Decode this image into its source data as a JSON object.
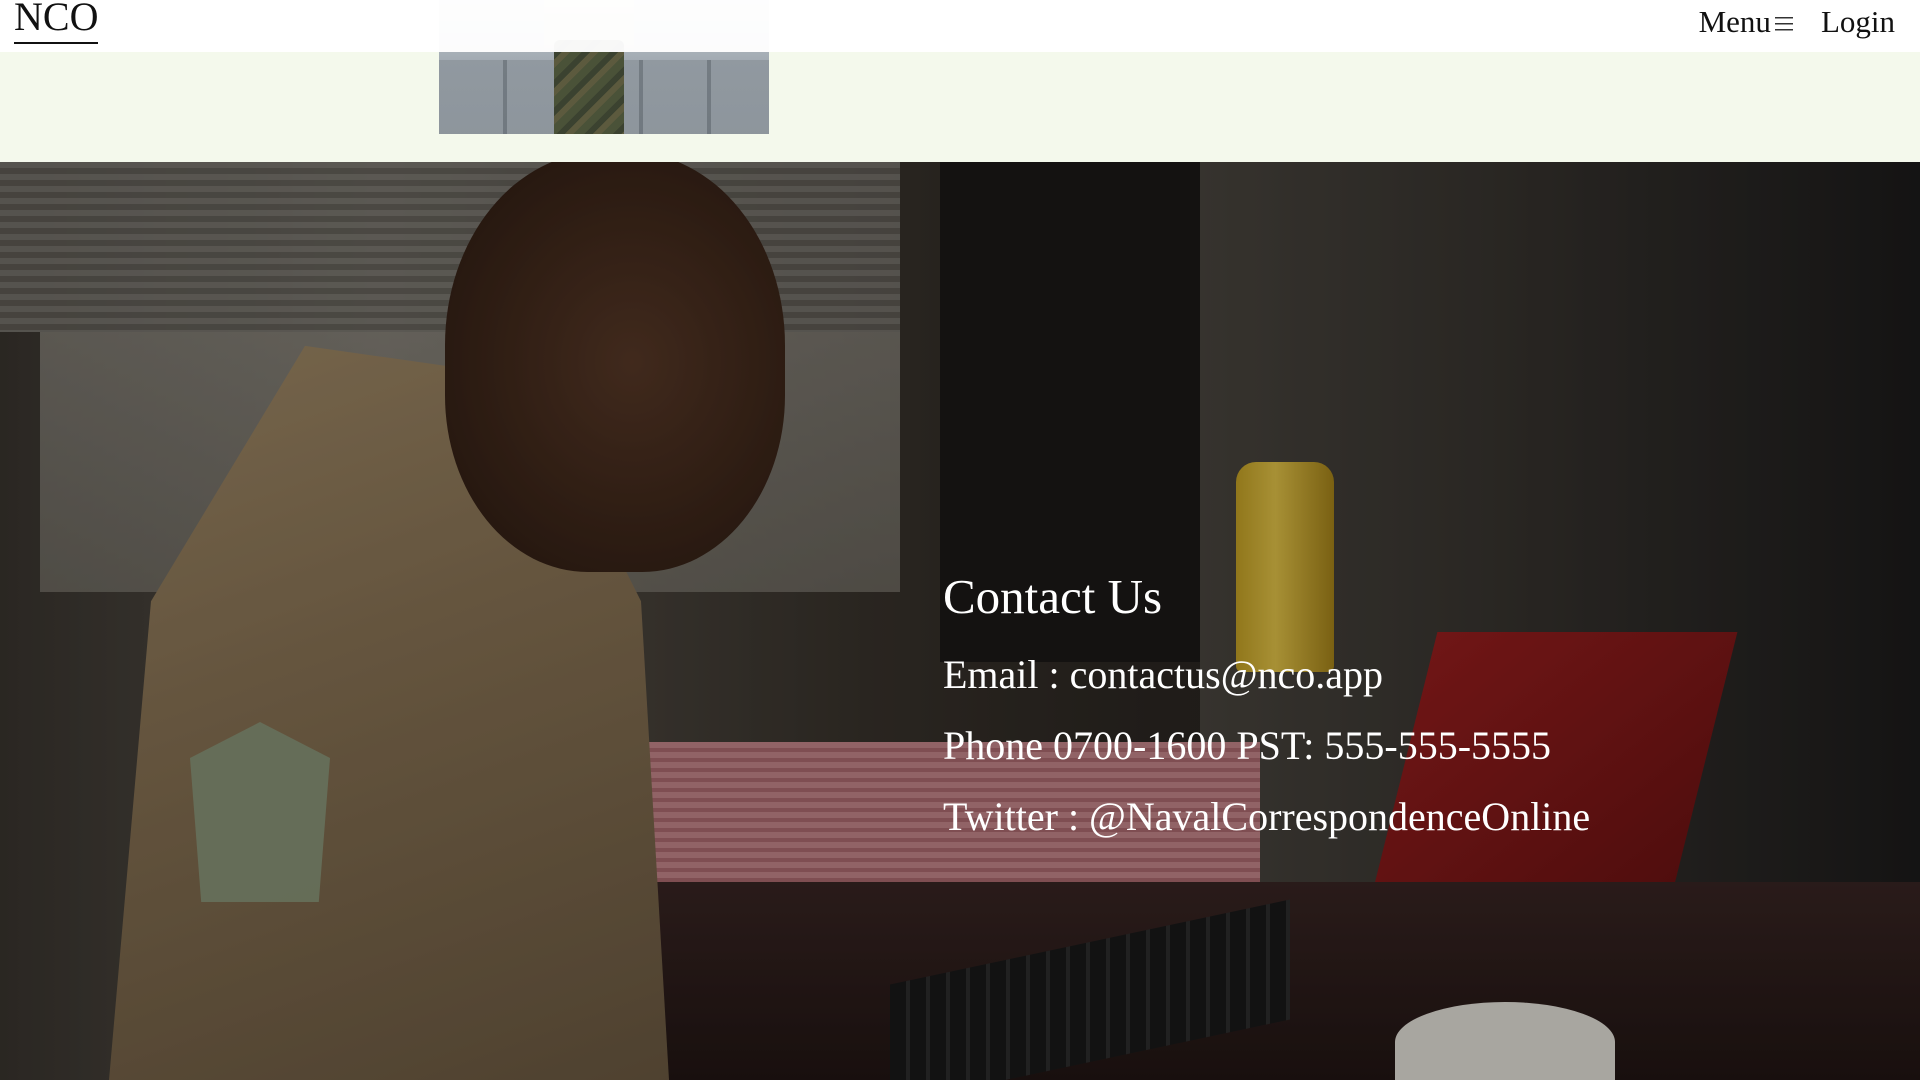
{
  "header": {
    "logo": "NCO",
    "nav": {
      "menu_label": "Menu",
      "menu_icon": "hamburger-icon",
      "login_label": "Login"
    }
  },
  "contact": {
    "heading": "Contact Us",
    "email_line": "Email : contactus@nco.app",
    "phone_line": "Phone 0700-1600 PST: 555-555-5555",
    "twitter_line": "Twitter : @NavalCorrespondenceOnline"
  },
  "colors": {
    "top_band": "#f4f9ec",
    "header_bg": "#ffffff",
    "text_dark": "#111111",
    "text_light": "#ffffff"
  }
}
